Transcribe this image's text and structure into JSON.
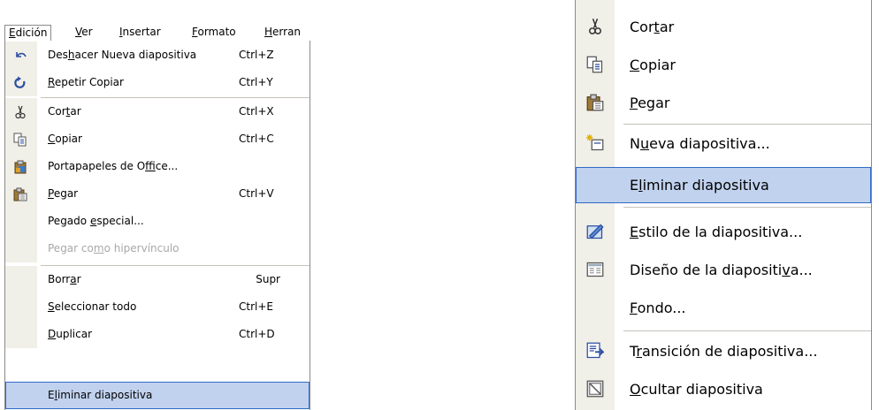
{
  "menubar": {
    "items": [
      {
        "pre": "",
        "mn": "E",
        "post": "dición"
      },
      {
        "pre": "",
        "mn": "V",
        "post": "er"
      },
      {
        "pre": "",
        "mn": "I",
        "post": "nsertar"
      },
      {
        "pre": "",
        "mn": "F",
        "post": "ormato"
      },
      {
        "pre": "",
        "mn": "H",
        "post": "erran"
      }
    ]
  },
  "edit_menu": {
    "items": [
      {
        "icon": "undo-icon",
        "pre": "Des",
        "mn": "h",
        "post": "acer Nueva diapositiva",
        "shortcut": "Ctrl+Z"
      },
      {
        "icon": "redo-icon",
        "pre": "",
        "mn": "R",
        "post": "epetir Copiar",
        "shortcut": "Ctrl+Y"
      },
      {
        "icon": "scissors-icon",
        "pre": "Cor",
        "mn": "t",
        "post": "ar",
        "shortcut": "Ctrl+X"
      },
      {
        "icon": "copy-icon",
        "pre": "",
        "mn": "C",
        "post": "opiar",
        "shortcut": "Ctrl+C"
      },
      {
        "icon": "office-clipboard-icon",
        "pre": "Portapapeles de O",
        "mn": "f",
        "post": "fice...",
        "shortcut": ""
      },
      {
        "icon": "paste-icon",
        "pre": "",
        "mn": "P",
        "post": "egar",
        "shortcut": "Ctrl+V"
      },
      {
        "icon": "",
        "pre": "Pegado ",
        "mn": "e",
        "post": "special...",
        "shortcut": ""
      },
      {
        "icon": "",
        "pre": "Pegar co",
        "mn": "m",
        "post": "o hipervínculo",
        "shortcut": ""
      },
      {
        "icon": "",
        "pre": "Borr",
        "mn": "a",
        "post": "r",
        "shortcut": "Supr"
      },
      {
        "icon": "",
        "pre": "",
        "mn": "S",
        "post": "eleccionar todo",
        "shortcut": "Ctrl+E"
      },
      {
        "icon": "",
        "pre": "",
        "mn": "D",
        "post": "uplicar",
        "shortcut": "Ctrl+D"
      },
      {
        "icon": "",
        "pre": "E",
        "mn": "l",
        "post": "iminar diapositiva",
        "shortcut": ""
      }
    ]
  },
  "context_menu": {
    "items": [
      {
        "icon": "scissors-icon",
        "pre": "Cor",
        "mn": "t",
        "post": "ar"
      },
      {
        "icon": "copy-icon",
        "pre": "",
        "mn": "C",
        "post": "opiar"
      },
      {
        "icon": "paste-icon",
        "pre": "",
        "mn": "P",
        "post": "egar"
      },
      {
        "icon": "new-slide-icon",
        "pre": "N",
        "mn": "u",
        "post": "eva diapositiva..."
      },
      {
        "icon": "",
        "pre": "E",
        "mn": "l",
        "post": "iminar diapositiva"
      },
      {
        "icon": "slide-style-icon",
        "pre": "",
        "mn": "E",
        "post": "stilo de la diapositiva..."
      },
      {
        "icon": "slide-layout-icon",
        "pre": "Diseño de la diapositi",
        "mn": "v",
        "post": "a..."
      },
      {
        "icon": "",
        "pre": "",
        "mn": "F",
        "post": "ondo..."
      },
      {
        "icon": "transition-icon",
        "pre": "T",
        "mn": "r",
        "post": "ansición de diapositiva..."
      },
      {
        "icon": "hide-slide-icon",
        "pre": "",
        "mn": "O",
        "post": "cultar diapositiva"
      }
    ]
  },
  "colors": {
    "highlight": "#c1d2ee",
    "highlight_border": "#316ac5",
    "gutter": "#f0efe8",
    "disabled_text": "#a8a8a8"
  }
}
